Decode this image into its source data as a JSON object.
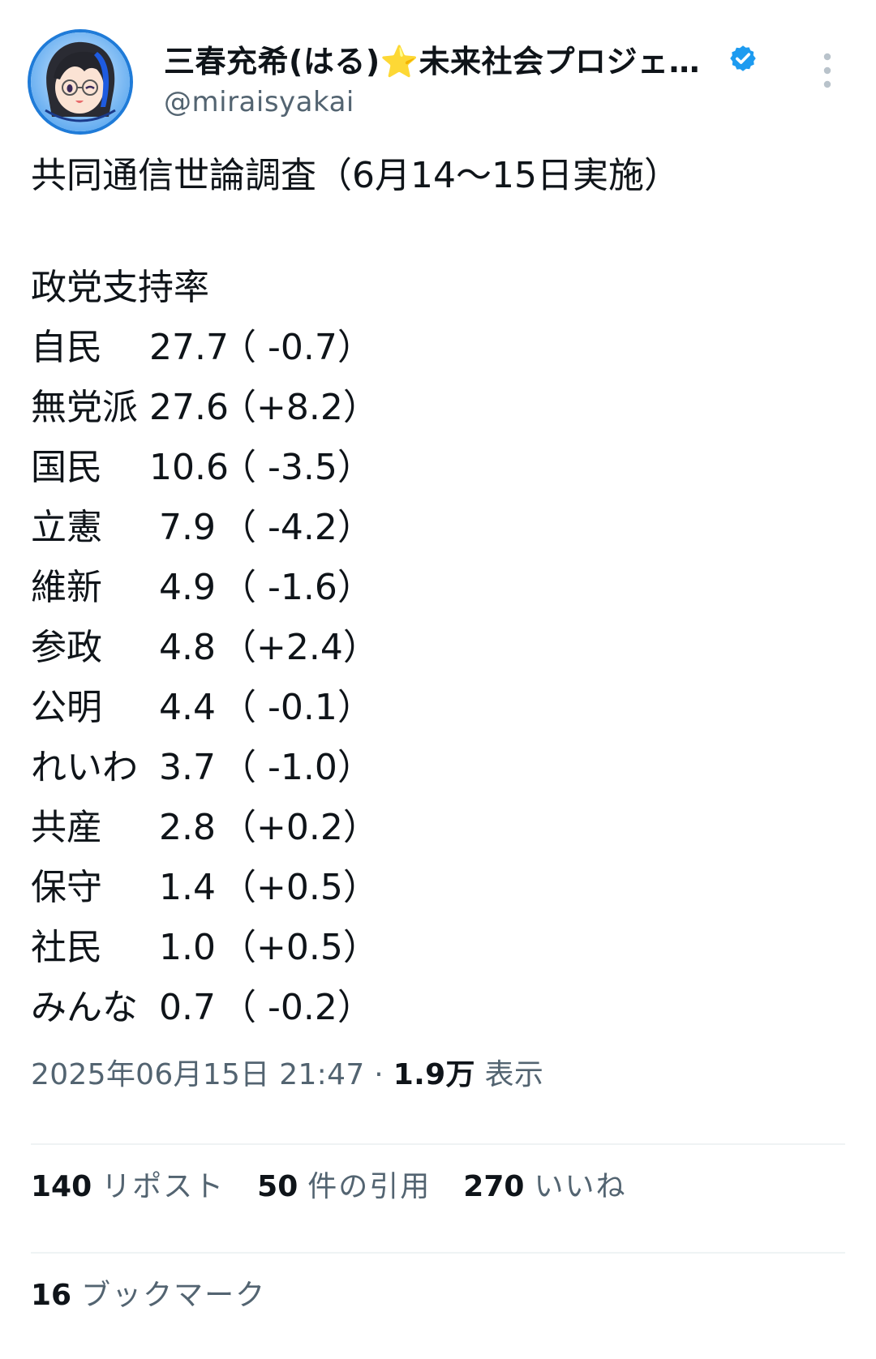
{
  "author": {
    "display_name": "三春充希(はる)⭐️未来社会プロジェク…",
    "handle": "@miraisyakai",
    "verified_color": "#1d9bf0"
  },
  "tweet": {
    "headline": "共同通信世論調査（6月14〜15日実施）",
    "section_title": "政党支持率",
    "rows": [
      {
        "party": "自民",
        "value": "27.7",
        "change": "（ -0.7）"
      },
      {
        "party": "無党派",
        "value": "27.6",
        "change": "（+8.2）"
      },
      {
        "party": "国民",
        "value": "10.6",
        "change": "（ -3.5）"
      },
      {
        "party": "立憲",
        "value": "7.9",
        "change": "（ -4.2）"
      },
      {
        "party": "維新",
        "value": "4.9",
        "change": "（ -1.6）"
      },
      {
        "party": "参政",
        "value": "4.8",
        "change": "（+2.4）"
      },
      {
        "party": "公明",
        "value": "4.4",
        "change": "（ -0.1）"
      },
      {
        "party": "れいわ",
        "value": "3.7",
        "change": "（ -1.0）"
      },
      {
        "party": "共産",
        "value": "2.8",
        "change": "（+0.2）"
      },
      {
        "party": "保守",
        "value": "1.4",
        "change": "（+0.5）"
      },
      {
        "party": "社民",
        "value": "1.0",
        "change": "（+0.5）"
      },
      {
        "party": "みんな",
        "value": "0.7",
        "change": "（ -0.2）"
      }
    ]
  },
  "meta": {
    "timestamp": "2025年06月15日 21:47",
    "separator": "·",
    "views_count": "1.9万",
    "views_label": "表示"
  },
  "stats": {
    "reposts": {
      "count": "140",
      "label": "リポスト"
    },
    "quotes": {
      "count": "50",
      "label": "件の引用"
    },
    "likes": {
      "count": "270",
      "label": "いいね"
    },
    "bookmarks": {
      "count": "16",
      "label": "ブックマーク"
    }
  }
}
